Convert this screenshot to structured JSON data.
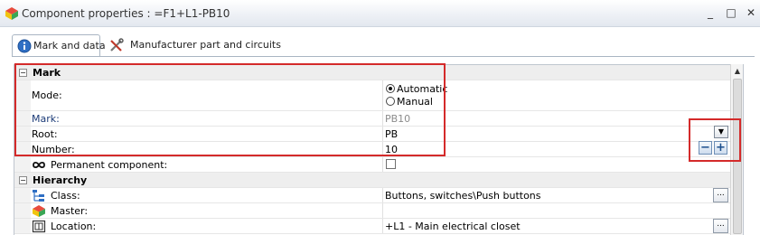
{
  "window": {
    "title": "Component properties : =F1+L1-PB10",
    "minimize_glyph": "_",
    "maximize_glyph": "□",
    "close_glyph": "✕"
  },
  "tabs": [
    {
      "label": "Mark and data",
      "icon": "info-icon",
      "active": true
    },
    {
      "label": "Manufacturer part and circuits",
      "icon": "tools-icon",
      "active": false
    }
  ],
  "grid": {
    "mark_section": {
      "title": "Mark",
      "expander": "−",
      "mode": {
        "label": "Mode:",
        "options": [
          {
            "label": "Automatic",
            "selected": true
          },
          {
            "label": "Manual",
            "selected": false
          }
        ]
      },
      "mark": {
        "label": "Mark:",
        "value": "PB10"
      },
      "root": {
        "label": "Root:",
        "value": "PB"
      },
      "number": {
        "label": "Number:",
        "value": "10"
      },
      "permanent": {
        "label": "Permanent component:",
        "icon": "infinity-icon",
        "checked": false
      }
    },
    "hierarchy_section": {
      "title": "Hierarchy",
      "expander": "−",
      "class": {
        "label": "Class:",
        "value": "Buttons, switches\\Push buttons",
        "icon": "tree-icon"
      },
      "master": {
        "label": "Master:",
        "value": "",
        "icon": "component-icon"
      },
      "location": {
        "label": "Location:",
        "value": "+L1 - Main electrical closet",
        "icon": "location-icon"
      }
    },
    "ellipsis_label": "...",
    "dropdown_glyph": "▼",
    "minus_glyph": "−",
    "plus_glyph": "+",
    "scroll_up_glyph": "▲"
  },
  "colors": {
    "highlight": "#d42a2a",
    "category_bg": "#eeeeee",
    "greyed_text": "#8c8c8c"
  }
}
